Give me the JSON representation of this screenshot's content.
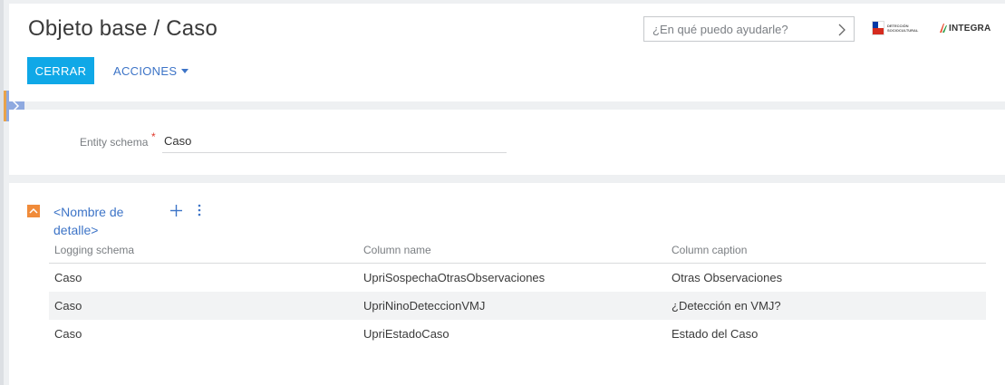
{
  "header": {
    "title": "Objeto base / Caso",
    "close_label": "CERRAR",
    "actions_label": "ACCIONES",
    "search_placeholder": "¿En qué puedo ayudarle?",
    "logos": {
      "primary_text": "DETECCIÓN SOCIOCULTURAL",
      "brand": "INTEGRA"
    }
  },
  "schema": {
    "label": "Entity schema",
    "required_mark": "*",
    "value": "Caso"
  },
  "detail": {
    "name": "<Nombre de detalle>",
    "columns": [
      "Logging schema",
      "Column name",
      "Column caption"
    ],
    "rows": [
      [
        "Caso",
        "UpriSospechaOtrasObservaciones",
        "Otras Observaciones"
      ],
      [
        "Caso",
        "UpriNinoDeteccionVMJ",
        "¿Detección en VMJ?"
      ],
      [
        "Caso",
        "UpriEstadoCaso",
        "Estado del Caso"
      ]
    ]
  },
  "colors": {
    "primary_button": "#0fa8e7",
    "link": "#3d74c7",
    "collapse": "#f08b3a",
    "panel_toggle": "#8ea9e0",
    "required": "#e0392b"
  },
  "icons": [
    "chevron-right-icon",
    "caret-down-icon",
    "chevron-up-icon",
    "plus-icon",
    "more-vertical-icon"
  ]
}
